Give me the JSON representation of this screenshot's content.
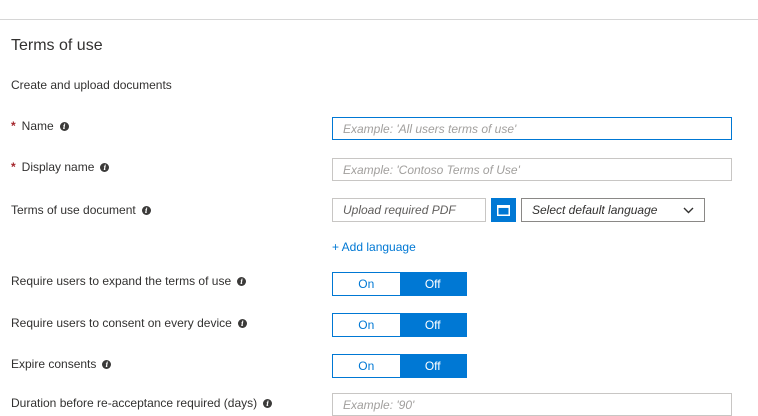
{
  "page": {
    "title": "Terms of use",
    "subtitle": "Create and upload documents"
  },
  "form": {
    "name": {
      "label": "Name",
      "placeholder": "Example: 'All users terms of use'"
    },
    "display_name": {
      "label": "Display name",
      "placeholder": "Example: 'Contoso Terms of Use'"
    },
    "document": {
      "label": "Terms of use document",
      "upload_placeholder": "Upload required PDF",
      "language_select": "Select default language",
      "add_language": "+ Add language"
    },
    "expand": {
      "label": "Require users to expand the terms of use",
      "on": "On",
      "off": "Off",
      "selected": "Off"
    },
    "consent_every_device": {
      "label": "Require users to consent on every device",
      "on": "On",
      "off": "Off",
      "selected": "Off"
    },
    "expire_consents": {
      "label": "Expire consents",
      "on": "On",
      "off": "Off",
      "selected": "Off"
    },
    "duration": {
      "label": "Duration before re-acceptance required (days)",
      "placeholder": "Example: '90'"
    }
  },
  "colors": {
    "accent": "#0078d4",
    "required": "#a4262c"
  },
  "icons": {
    "info": "info-icon",
    "browse": "folder-icon",
    "dropdown": "chevron-down-icon"
  }
}
